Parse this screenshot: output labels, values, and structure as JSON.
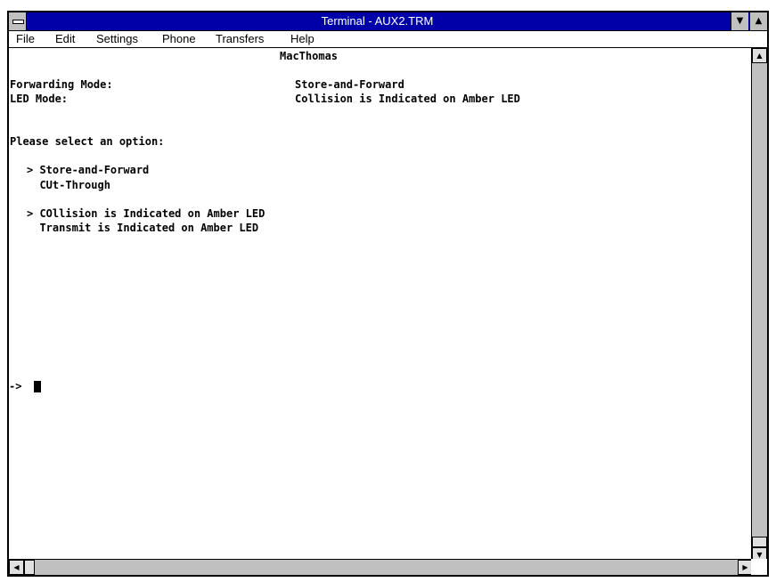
{
  "window": {
    "title": "Terminal - AUX2.TRM"
  },
  "menu": {
    "file": "File",
    "edit": "Edit",
    "settings": "Settings",
    "phone": "Phone",
    "transfers": "Transfers",
    "help": "Help"
  },
  "terminal": {
    "header": "MacThomas",
    "forwarding_label": "Forwarding Mode:",
    "forwarding_value": "Store-and-Forward",
    "led_label": "LED Mode:",
    "led_value": "Collision is Indicated on Amber LED",
    "prompt": "Please select an option:",
    "option1a": "> Store-and-Forward",
    "option1b": "  CUt-Through",
    "option2a": "> COllision is Indicated on Amber LED",
    "option2b": "  Transmit is Indicated on Amber LED",
    "command_prompt": "-> "
  },
  "icons": {
    "system_menu": "system-menu-icon",
    "minimize": "minimize-arrow-icon",
    "maximize": "maximize-arrow-icon",
    "scroll_up": "arrow-up-icon",
    "scroll_down": "arrow-down-icon",
    "scroll_left": "arrow-left-icon",
    "scroll_right": "arrow-right-icon"
  },
  "colors": {
    "titlebar": "#0000a8",
    "chrome": "#c0c0c0"
  }
}
